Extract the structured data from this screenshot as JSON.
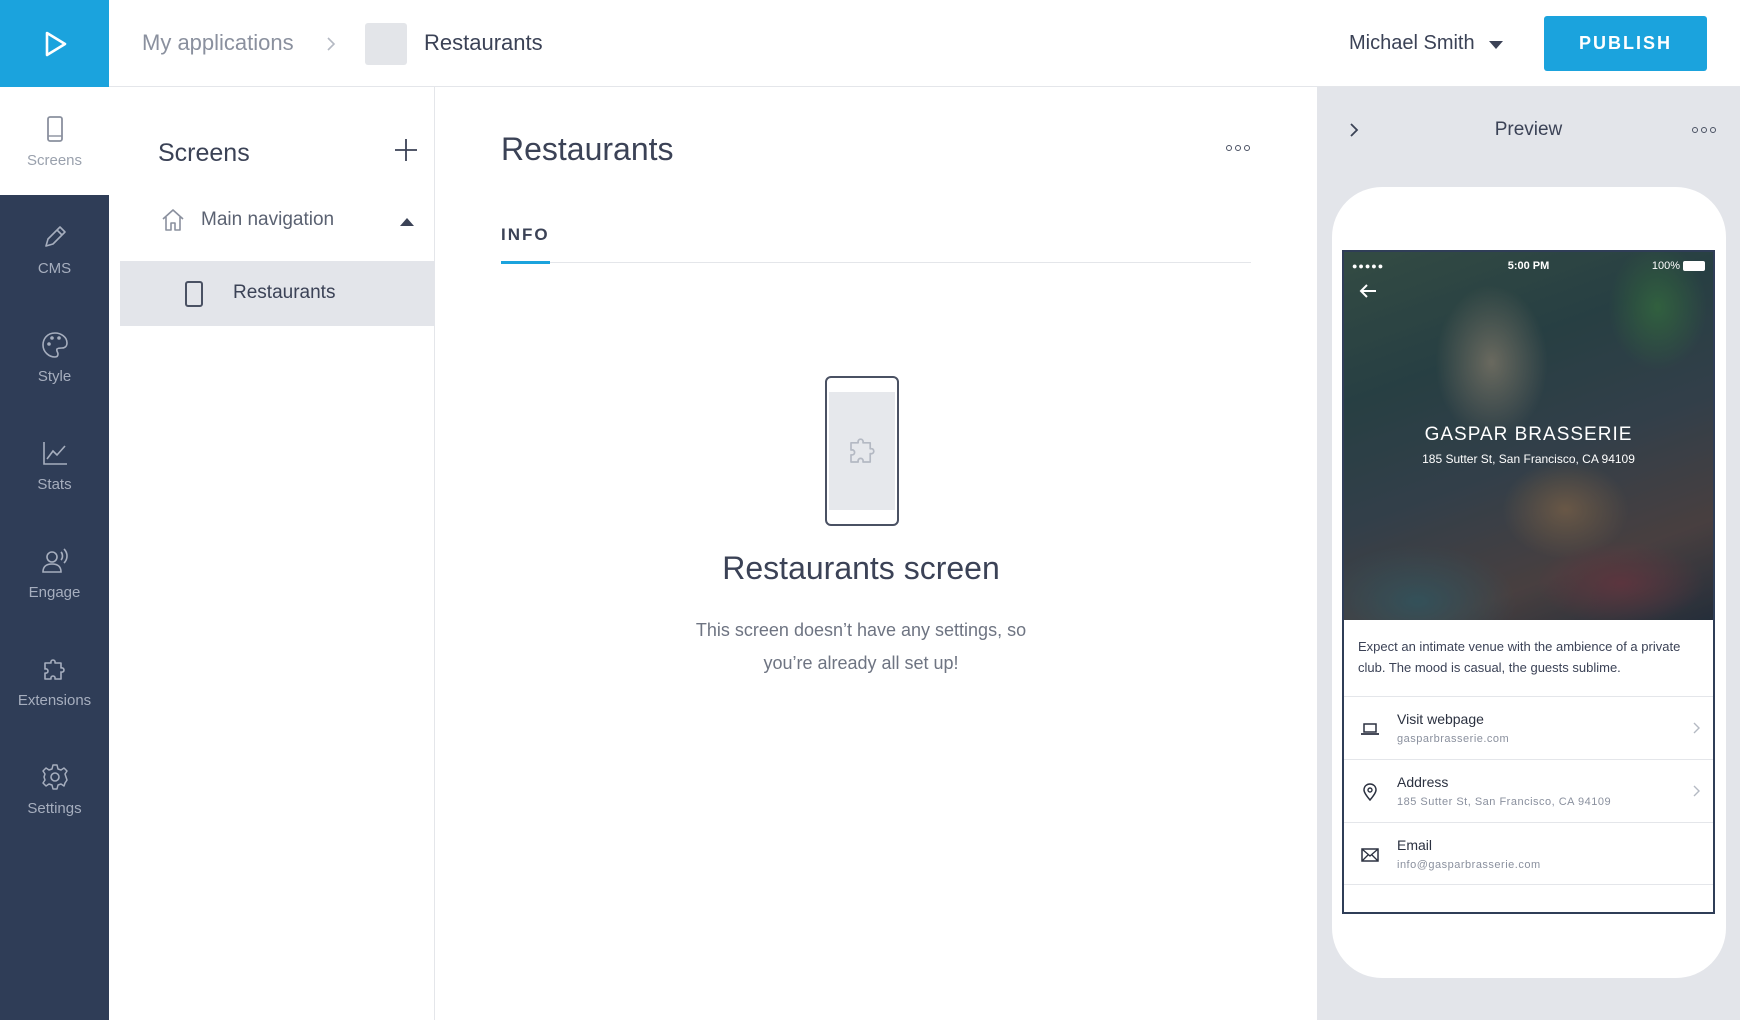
{
  "breadcrumb": {
    "apps": "My applications",
    "current": "Restaurants"
  },
  "header": {
    "user_name": "Michael Smith",
    "publish_label": "PUBLISH"
  },
  "leftnav": {
    "items": [
      {
        "label": "Screens",
        "icon": "phone-icon",
        "active": true
      },
      {
        "label": "CMS",
        "icon": "pencil-icon"
      },
      {
        "label": "Style",
        "icon": "palette-icon"
      },
      {
        "label": "Stats",
        "icon": "chart-icon"
      },
      {
        "label": "Engage",
        "icon": "engage-icon"
      },
      {
        "label": "Extensions",
        "icon": "puzzle-icon"
      },
      {
        "label": "Settings",
        "icon": "gear-icon"
      }
    ]
  },
  "screens_panel": {
    "title": "Screens",
    "group_label": "Main navigation",
    "screen_label": "Restaurants"
  },
  "main": {
    "title": "Restaurants",
    "tab_info": "INFO",
    "empty_title": "Restaurants screen",
    "empty_desc": "This screen doesn’t have any settings, so you’re already all set up!"
  },
  "preview": {
    "title": "Preview",
    "status_time": "5:00 PM",
    "status_battery": "100%",
    "hero_title": "GASPAR BRASSERIE",
    "hero_subtitle": "185 Sutter St, San Francisco, CA 94109",
    "description": "Expect an intimate venue with the ambience of a private club. The mood is casual, the guests sublime.",
    "rows": [
      {
        "title": "Visit webpage",
        "subtitle": "gasparbrasserie.com",
        "icon": "laptop-icon"
      },
      {
        "title": "Address",
        "subtitle": "185 Sutter St, San Francisco, CA 94109",
        "icon": "location-pin-icon"
      },
      {
        "title": "Email",
        "subtitle": "info@gasparbrasserie.com",
        "icon": "envelope-icon"
      }
    ]
  },
  "colors": {
    "accent": "#1ba3dd",
    "nav_bg": "#2f3d57",
    "panel_bg": "#e3e5ea"
  }
}
